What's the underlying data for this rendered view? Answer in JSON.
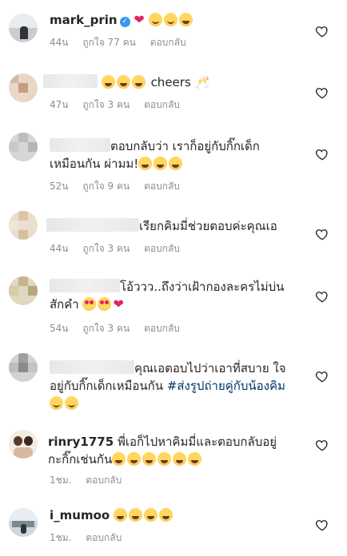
{
  "comments": [
    {
      "username": "mark_prin",
      "text": "",
      "time": "44น",
      "likes": "ถูกใจ 77 คน",
      "reply": "ตอบกลับ"
    },
    {
      "text": "cheers",
      "time": "47น",
      "likes": "ถูกใจ 3 คน",
      "reply": "ตอบกลับ"
    },
    {
      "line1": "ตอบกลับว่า เราก็อยู่กับกิ๊กเด็ก",
      "line2": "เหมือนกัน ผ่ามม!",
      "time": "52น",
      "likes": "ถูกใจ 9 คน",
      "reply": "ตอบกลับ"
    },
    {
      "text": "เรียกคิมมี่ช่วยตอบค่ะคุณเอ",
      "time": "44น",
      "likes": "ถูกใจ 3 คน",
      "reply": "ตอบกลับ"
    },
    {
      "line1": "โอ้ววว..ถึงว่าเฝ้ากองละครไม่บ่น",
      "line2": "สักคำ",
      "time": "54น",
      "likes": "ถูกใจ 3 คน",
      "reply": "ตอบกลับ"
    },
    {
      "line1": "คุณเอตอบไปว่าเอาที่สบาย ใจ",
      "line2": "อยู่กับกิ๊กเด็กเหมือนกัน",
      "hashtag": "#ส่งรูปถ่ายคู่กับน้องคิม",
      "time": "",
      "likes": "",
      "reply": ""
    },
    {
      "username": "rinry1775",
      "line1": "พี่เอก็ไปหาคิมมี่และตอบกลับอยู่",
      "line2": "กะกิ๊กเช่นกัน",
      "time": "1ชม.",
      "reply": "ตอบกลับ"
    },
    {
      "username": "i_mumoo",
      "time": "1ชม.",
      "reply": "ตอบกลับ"
    }
  ],
  "icons": {
    "like": "heart-outline-icon",
    "verified": "verified-badge-icon"
  },
  "colors": {
    "text": "#262626",
    "meta": "#8e8e8e",
    "verified": "#3897f0",
    "heart": "#e0245e",
    "hashtag": "#003569"
  }
}
